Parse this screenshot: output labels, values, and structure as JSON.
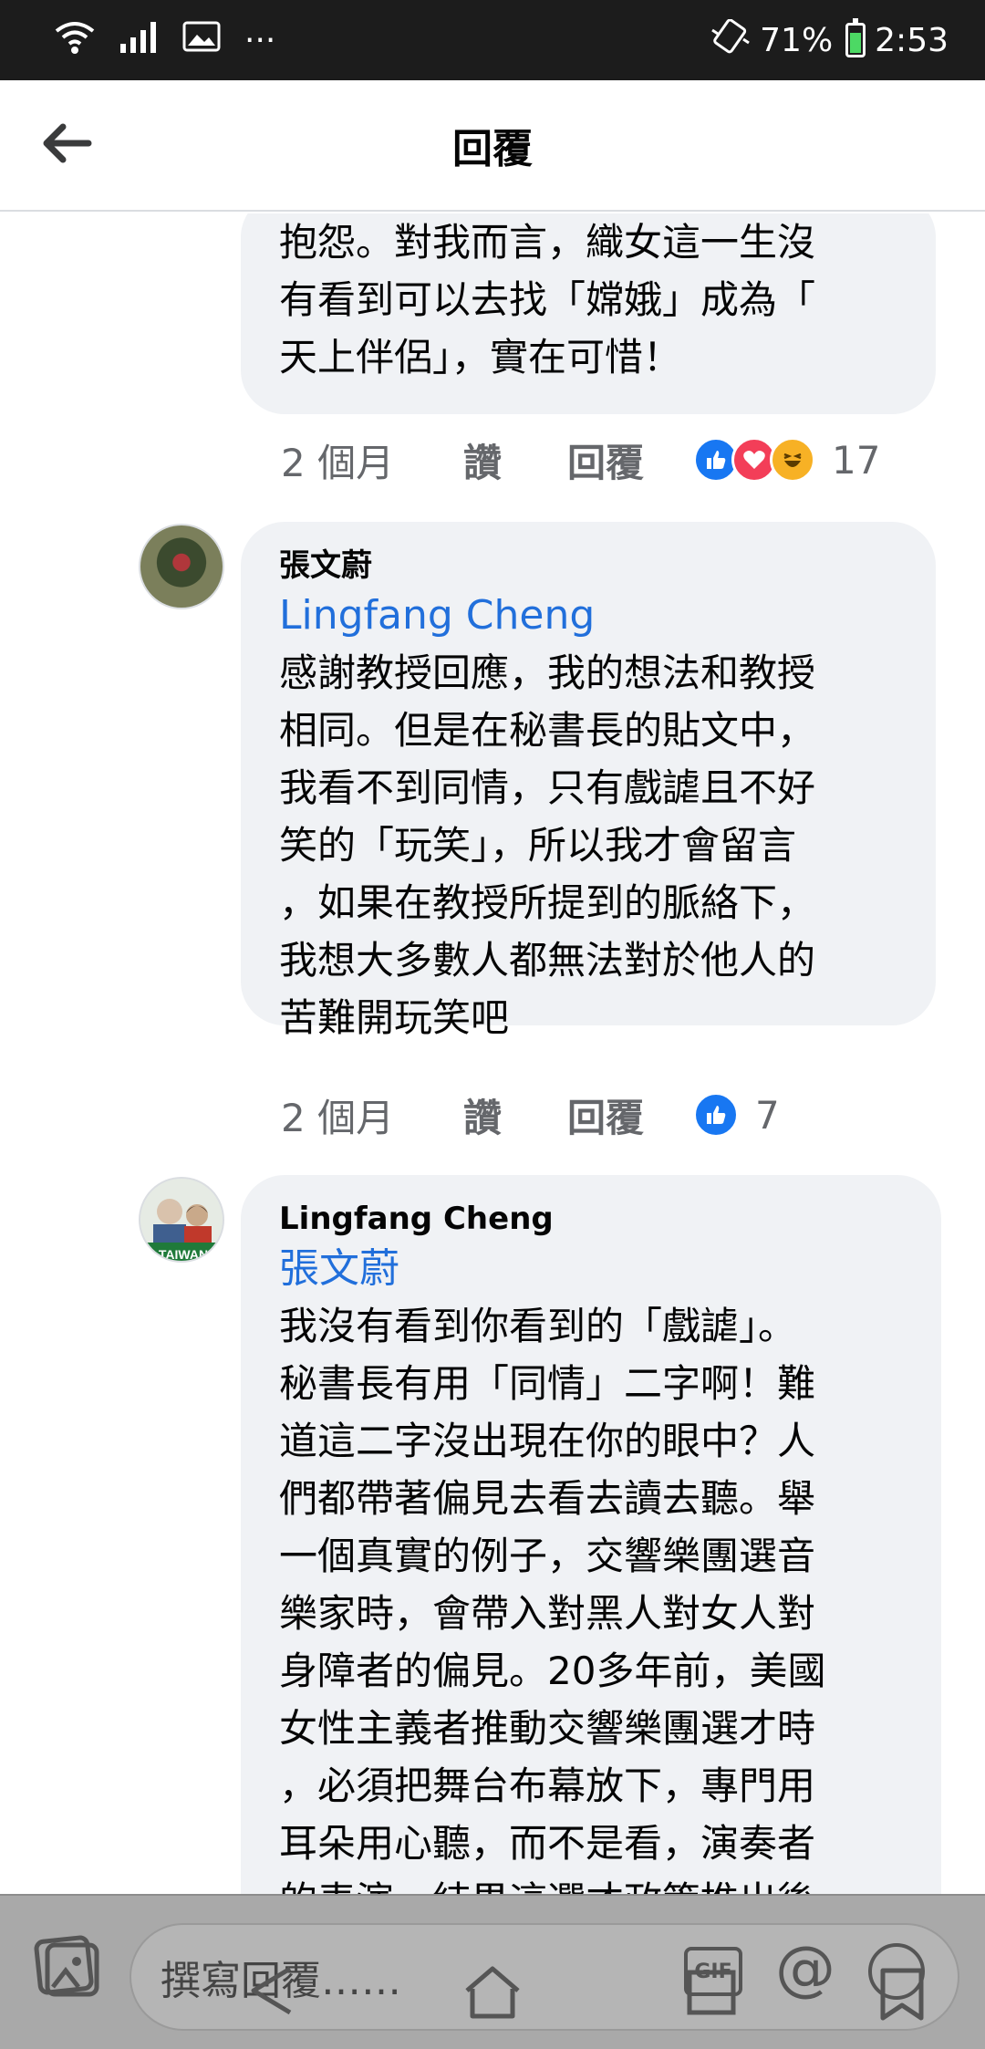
{
  "status_bar": {
    "more_indicator": "···",
    "battery_percent": "71%",
    "time": "2:53"
  },
  "header": {
    "title": "回覆"
  },
  "comments": [
    {
      "text": "抱怨。對我而言，織女這一生沒\n有看到可以去找「嫦娥」成為「\n天上伴侶」，實在可惜！",
      "meta": {
        "time": "2 個月",
        "like_label": "讚",
        "reply_label": "回覆",
        "reaction_count": "17"
      },
      "reactions": [
        "like",
        "love",
        "haha"
      ]
    },
    {
      "author": "張文蔚",
      "mention": "Lingfang Cheng",
      "text": "感謝教授回應，我的想法和教授\n相同。但是在秘書長的貼文中，\n我看不到同情，只有戲謔且不好\n笑的「玩笑」，所以我才會留言\n，如果在教授所提到的脈絡下，\n我想大多數人都無法對於他人的\n苦難開玩笑吧",
      "meta": {
        "time": "2 個月",
        "like_label": "讚",
        "reply_label": "回覆",
        "reaction_count": "7"
      },
      "reactions": [
        "like"
      ]
    },
    {
      "author": "Lingfang Cheng",
      "avatar_badge": "TAIWAN",
      "mention": "張文蔚",
      "text": "我沒有看到你看到的「戲謔」。\n秘書長有用「同情」二字啊！難\n道這二字沒出現在你的眼中？人\n們都帶著偏見去看去讀去聽。舉\n一個真實的例子，交響樂團選音\n樂家時，會帶入對黑人對女人對\n身障者的偏見。20多年前，美國\n女性主義者推動交響樂團選才時\n，必須把舞台布幕放下，專門用\n耳朵用心聽，而不是看，演奏者\n的表演，結果這選才政策推出後"
    }
  ],
  "compose": {
    "placeholder": "撰寫回覆……",
    "gif_label": "GIF",
    "at_label": "@"
  },
  "icons": {
    "back": "arrow-left-icon",
    "wifi": "wifi-icon",
    "signal": "signal-icon",
    "gallery": "image-icon",
    "vibrate": "vibrate-icon",
    "battery": "battery-charging-icon"
  },
  "colors": {
    "bubble": "#f0f2f5",
    "mention": "#216fdb",
    "like_blue": "#1877f2",
    "love_red": "#f33e58",
    "haha_yellow": "#f7b125"
  }
}
